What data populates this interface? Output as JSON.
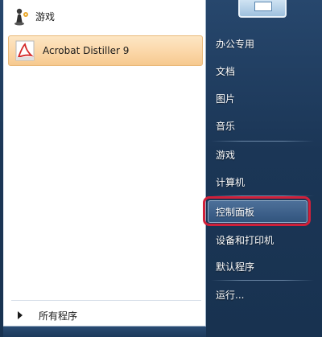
{
  "left": {
    "programs": [
      {
        "label": "游戏",
        "icon": "games-icon"
      },
      {
        "label": "Acrobat Distiller 9",
        "icon": "acrobat-distiller-icon"
      }
    ],
    "all_programs": "所有程序"
  },
  "right": {
    "items": [
      {
        "label": "办公专用"
      },
      {
        "label": "文档"
      },
      {
        "label": "图片"
      },
      {
        "label": "音乐"
      },
      {
        "label": "游戏"
      },
      {
        "label": "计算机"
      },
      {
        "label": "控制面板"
      },
      {
        "label": "设备和打印机"
      },
      {
        "label": "默认程序"
      },
      {
        "label": "运行..."
      }
    ]
  },
  "colors": {
    "highlight": "#d0203a",
    "selected_left": "#fbd7a8"
  }
}
